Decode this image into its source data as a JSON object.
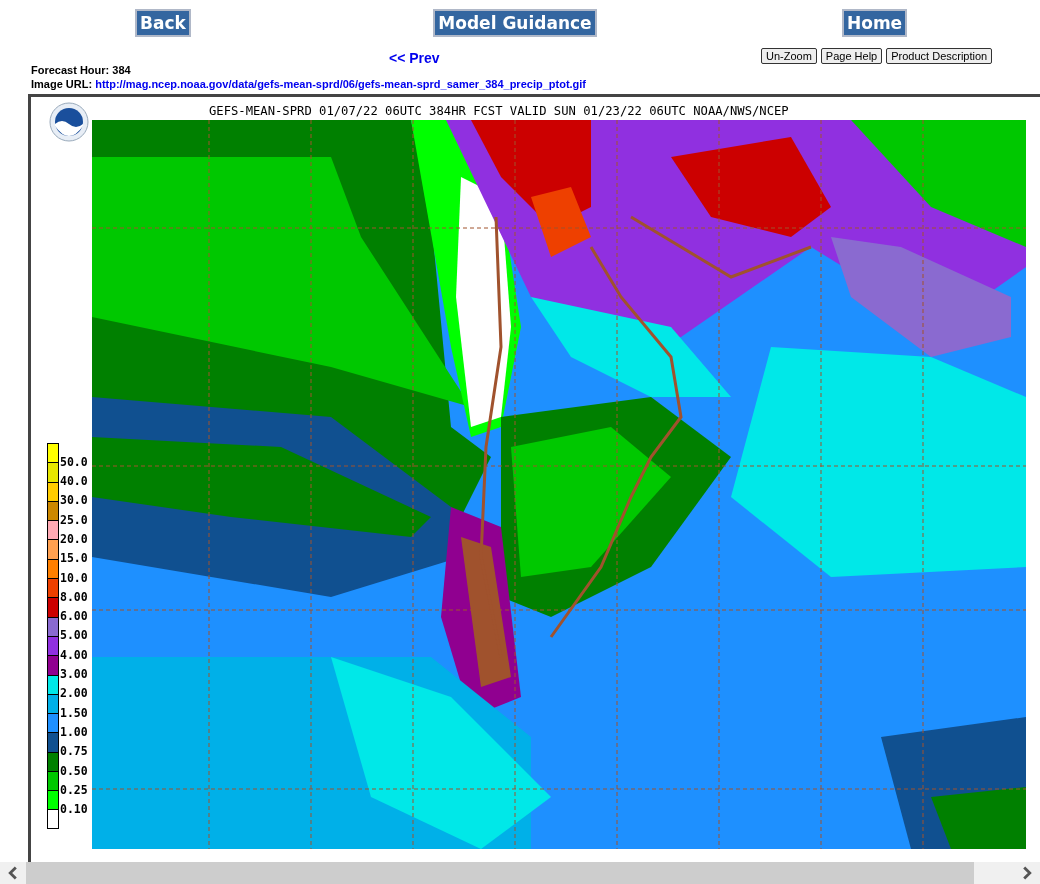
{
  "nav_buttons": [
    "Back",
    "Model Guidance",
    "Home"
  ],
  "prev_link": "<< Prev",
  "tool_buttons": [
    "Un-Zoom",
    "Page Help",
    "Product Description"
  ],
  "forecast_hour": {
    "label": "Forecast Hour:",
    "value": "384"
  },
  "image_url": {
    "label": "Image URL:",
    "value": "http://mag.ncep.noaa.gov/data/gefs-mean-sprd/06/gefs-mean-sprd_samer_384_precip_ptot.gif"
  },
  "map": {
    "title": "GEFS-MEAN-SPRD 01/07/22 06UTC 384HR FCST VALID SUN 01/23/22 06UTC NOAA/NWS/NCEP",
    "legend": [
      {
        "label": "50.0",
        "color": "#ffff00"
      },
      {
        "label": "40.0",
        "color": "#e6e600"
      },
      {
        "label": "30.0",
        "color": "#ffcc00"
      },
      {
        "label": "25.0",
        "color": "#cc8800"
      },
      {
        "label": "20.0",
        "color": "#ffaab4"
      },
      {
        "label": "15.0",
        "color": "#ffa050"
      },
      {
        "label": "10.0",
        "color": "#ff7f00"
      },
      {
        "label": "8.00",
        "color": "#ee4000"
      },
      {
        "label": "6.00",
        "color": "#cc0000"
      },
      {
        "label": "5.00",
        "color": "#8a6ad0"
      },
      {
        "label": "4.00",
        "color": "#9030e0"
      },
      {
        "label": "3.00",
        "color": "#900090"
      },
      {
        "label": "2.00",
        "color": "#00e8e8"
      },
      {
        "label": "1.50",
        "color": "#00b0e8"
      },
      {
        "label": "1.00",
        "color": "#1e90ff"
      },
      {
        "label": "0.75",
        "color": "#105090"
      },
      {
        "label": "0.50",
        "color": "#008000"
      },
      {
        "label": "0.25",
        "color": "#00c800"
      },
      {
        "label": "0.10",
        "color": "#00ff00"
      },
      {
        "color": "#ffffff"
      }
    ]
  }
}
